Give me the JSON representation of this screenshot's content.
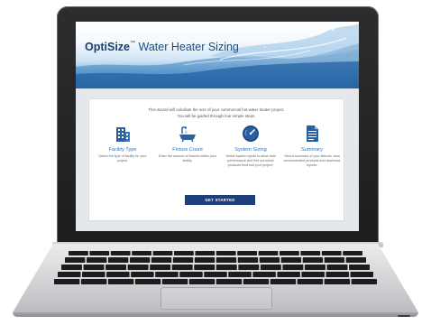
{
  "app": {
    "brand": "OptiSize",
    "trademark": "™",
    "subtitle": "Water Heater Sizing"
  },
  "intro": {
    "line1": "This wizard will calculate the size of your commercial hot water heater project.",
    "line2": "You will be guided through four simple steps."
  },
  "steps": [
    {
      "icon": "building-icon",
      "title": "Facility Type",
      "desc": "Select the type of facility for your project."
    },
    {
      "icon": "bathtub-icon",
      "title": "Fixture Count",
      "desc": "Enter the amount of fixtures within your facility."
    },
    {
      "icon": "gauge-icon",
      "title": "System Sizing",
      "desc": "Select system inputs to allow total performance and find out which products best suit your project."
    },
    {
      "icon": "document-icon",
      "title": "Summary",
      "desc": "View a summary of your fixtures, view recommended products and download reports."
    }
  ],
  "cta": {
    "label": "GET STARTED"
  },
  "colors": {
    "accent": "#2f73b9",
    "button": "#1e3f79",
    "banner_water": "#2f6fae"
  }
}
